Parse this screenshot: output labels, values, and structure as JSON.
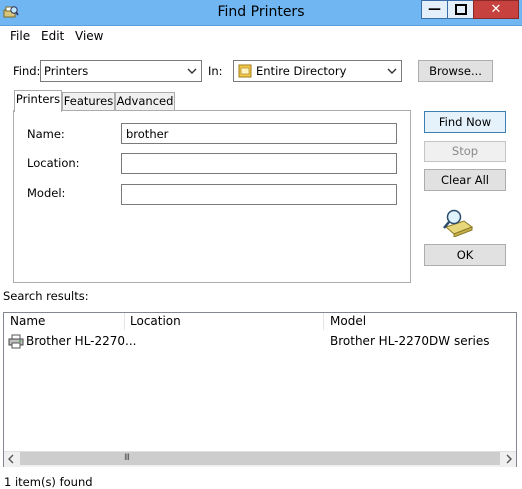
{
  "window": {
    "title": "Find Printers"
  },
  "menu": [
    "File",
    "Edit",
    "View"
  ],
  "find_row": {
    "find_label": "Find:",
    "find_value": "Printers",
    "in_label": "In:",
    "in_value": "Entire Directory",
    "browse_label": "Browse..."
  },
  "tabs": [
    "Printers",
    "Features",
    "Advanced"
  ],
  "form": {
    "name_label": "Name:",
    "name_value": "brother",
    "location_label": "Location:",
    "location_value": "",
    "model_label": "Model:",
    "model_value": ""
  },
  "buttons": {
    "find_now": "Find Now",
    "stop": "Stop",
    "clear_all": "Clear All",
    "ok": "OK"
  },
  "results": {
    "label": "Search results:",
    "columns": [
      "Name",
      "Location",
      "Model"
    ],
    "rows": [
      {
        "name": "Brother HL-2270...",
        "location": "",
        "model": "Brother HL-2270DW series"
      }
    ],
    "scroll_thumb_glyph": "III"
  },
  "status": {
    "text": "1 item(s) found"
  },
  "icons": {
    "app": "find-printers-icon",
    "combo_in": "directory-icon",
    "search_anim": "magnifier-search-icon",
    "row": "printer-icon"
  },
  "colors": {
    "titlebar": "#6fb6f2",
    "close": "#c7413e",
    "accent_border": "#3c7fb1"
  }
}
